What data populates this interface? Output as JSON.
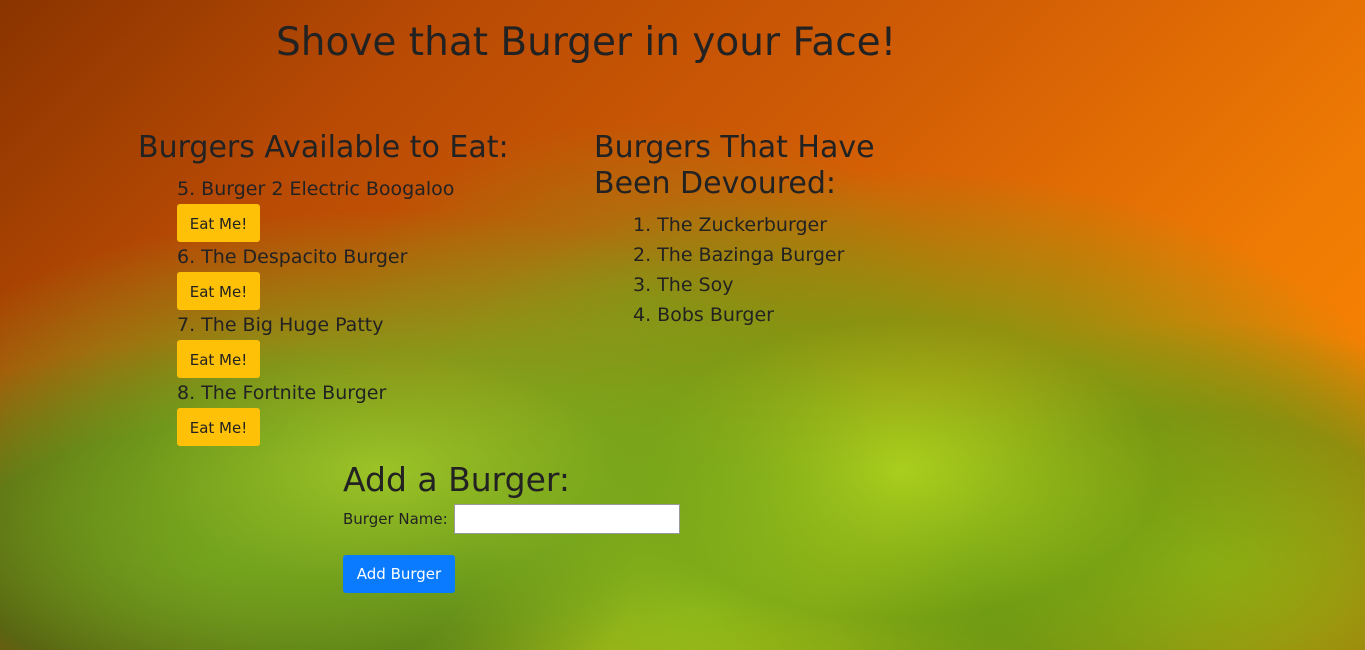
{
  "header": {
    "title": "Shove that Burger in your Face!"
  },
  "available": {
    "heading": "Burgers Available to Eat:",
    "button_label": "Eat Me!",
    "items": [
      {
        "label": "5. Burger 2 Electric Boogaloo"
      },
      {
        "label": "6. The Despacito Burger"
      },
      {
        "label": "7. The Big Huge Patty"
      },
      {
        "label": "8. The Fortnite Burger"
      }
    ]
  },
  "devoured": {
    "heading_line1": "Burgers That Have",
    "heading_line2": "Been Devoured:",
    "items": [
      {
        "label": "1. The Zuckerburger"
      },
      {
        "label": "2. The Bazinga Burger"
      },
      {
        "label": "3. The Soy"
      },
      {
        "label": "4. Bobs Burger"
      }
    ]
  },
  "add_form": {
    "heading": "Add a Burger:",
    "field_label": "Burger Name:",
    "field_value": "",
    "submit_label": "Add Burger"
  },
  "colors": {
    "eat_button": "#ffc107",
    "add_button": "#0a7bff"
  }
}
